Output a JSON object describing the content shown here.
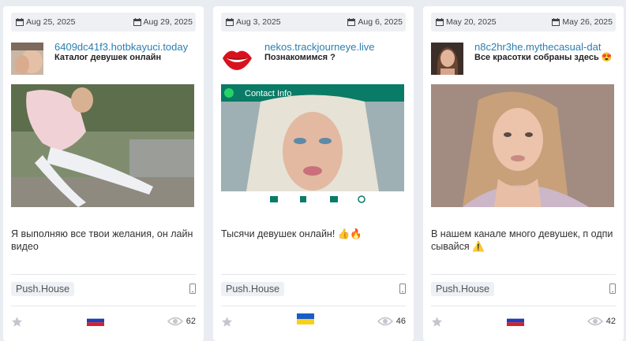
{
  "cards": [
    {
      "date_start": "Aug 25, 2025",
      "date_end": "Aug 29, 2025",
      "domain": "6409dc41f3.hotbkayuci.today",
      "title": "Каталог девушек онлайн",
      "description": "Я выполняю все твои желания, он лайн видео",
      "network": "Push.House",
      "country_flag": "russia",
      "views": "62",
      "avatar": "avatar-image",
      "photo": "creative-image"
    },
    {
      "date_start": "Aug 3, 2025",
      "date_end": "Aug 6, 2025",
      "domain": "nekos.trackjourneye.live",
      "title": "Познакомимся ?",
      "description": "Тысячи девушек онлайн! 👍🔥",
      "photo_caption": "Contact Info",
      "network": "Push.House",
      "country_flag": "ukraine",
      "views": "46",
      "avatar": "lips-icon",
      "photo": "creative-image"
    },
    {
      "date_start": "May 20, 2025",
      "date_end": "May 26, 2025",
      "domain": "n8c2hr3he.mythecasual-dat",
      "title": "Все красотки собраны здесь 😍",
      "description": "В нашем канале много девушек, п одписывайся ⚠️",
      "network": "Push.House",
      "country_flag": "russia",
      "views": "42",
      "avatar": "avatar-image",
      "photo": "creative-image"
    }
  ],
  "colors": {
    "background": "#e9edf1",
    "card": "#ffffff",
    "domain_link": "#2a7fb0",
    "tag_background": "#edf0f4"
  }
}
